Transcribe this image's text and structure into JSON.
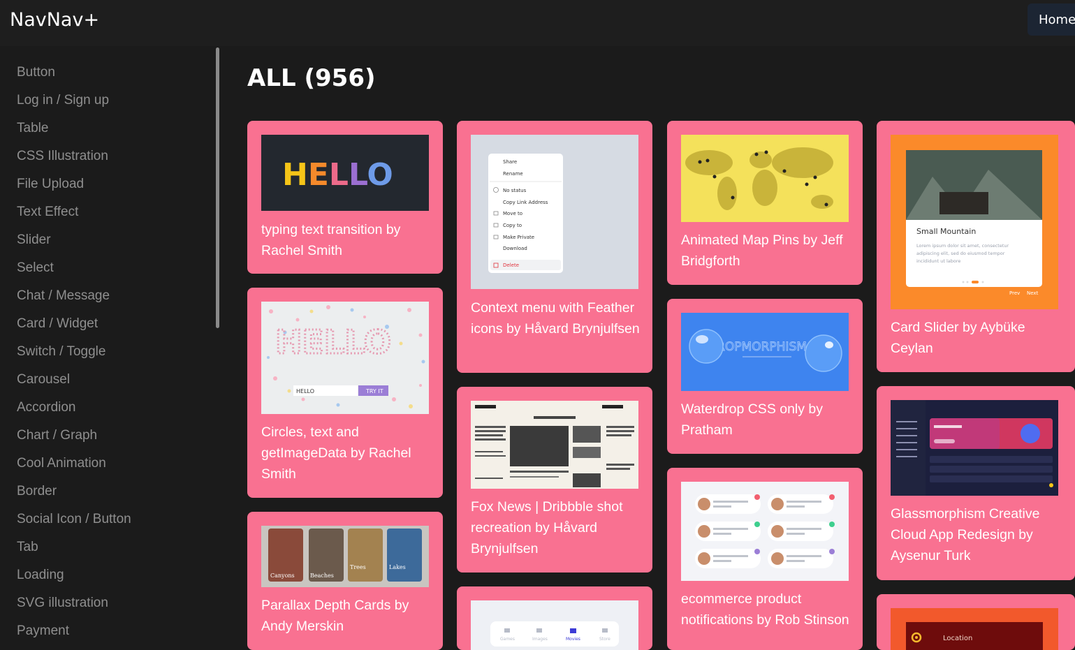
{
  "app": {
    "brand": "NavNav+",
    "home_label": "Home"
  },
  "sidebar": {
    "items": [
      "Button",
      "Log in / Sign up",
      "Table",
      "CSS Illustration",
      "File Upload",
      "Text Effect",
      "Slider",
      "Select",
      "Chat / Message",
      "Card / Widget",
      "Switch / Toggle",
      "Carousel",
      "Accordion",
      "Chart / Graph",
      "Cool Animation",
      "Border",
      "Social Icon / Button",
      "Tab",
      "Loading",
      "SVG illustration",
      "Payment"
    ]
  },
  "main": {
    "title": "ALL (956)"
  },
  "cards": [
    {
      "title": "typing text transition by Rachel Smith",
      "thumb_text": "HELLO"
    },
    {
      "title": "Circles, text and getImageData by Rachel Smith",
      "thumb_text": "HELLO",
      "input_value": "HELLO",
      "button_label": "TRY IT"
    },
    {
      "title": "Parallax Depth Cards by Andy Merskin",
      "labels": [
        "Canyons",
        "Beaches",
        "Trees",
        "Lakes"
      ]
    },
    {
      "title": "Context menu with Feather icons by Håvard Brynjulfsen",
      "menu_items": [
        "Share",
        "Rename",
        "No status",
        "Copy Link Address",
        "Move to",
        "Copy to",
        "Make Private",
        "Download",
        "Delete"
      ]
    },
    {
      "title": "Fox News | Dribbble shot recreation by Håvard Brynjulfsen"
    },
    {
      "title": "",
      "nav_items": [
        "Games",
        "Images",
        "Movies",
        "Store"
      ]
    },
    {
      "title": "Animated Map Pins by Jeff Bridgforth"
    },
    {
      "title": "Waterdrop CSS only by Pratham",
      "thumb_text": "DROPMORPHISM"
    },
    {
      "title": "ecommerce product notifications by Rob Stinson"
    },
    {
      "title": "Card Slider by Aybüke Ceylan",
      "slide_title": "Small Mountain",
      "slide_text": "Lorem ipsum dolor sit amet, consectetur adipiscing elit, sed do eiusmod tempor incididunt ut labore",
      "prev": "Prev",
      "next": "Next"
    },
    {
      "title": "Glassmorphism Creative Cloud App Redesign by Aysenur Turk"
    },
    {
      "title": "",
      "thumb_text": "Location"
    }
  ]
}
